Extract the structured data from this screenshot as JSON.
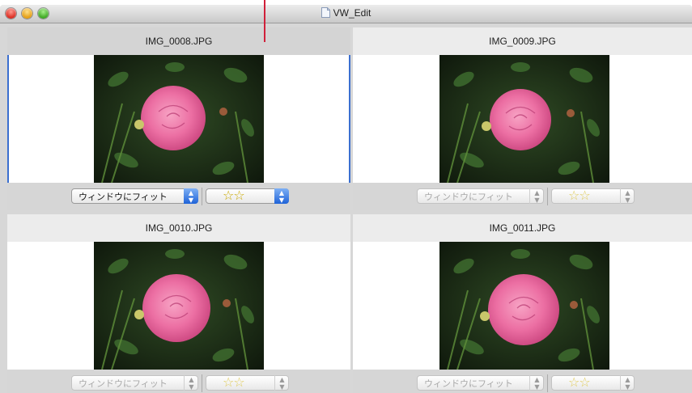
{
  "window": {
    "title": "VW_Edit"
  },
  "panes": [
    {
      "filename": "IMG_0008.JPG",
      "zoom_label": "ウィンドウにフィット",
      "rating_label": "☆☆",
      "active": true
    },
    {
      "filename": "IMG_0009.JPG",
      "zoom_label": "ウィンドウにフィット",
      "rating_label": "☆☆",
      "active": false
    },
    {
      "filename": "IMG_0010.JPG",
      "zoom_label": "ウィンドウにフィット",
      "rating_label": "☆☆",
      "active": false
    },
    {
      "filename": "IMG_0011.JPG",
      "zoom_label": "ウィンドウにフィット",
      "rating_label": "☆☆",
      "active": false
    }
  ],
  "colors": {
    "selection_border": "#3b6fd0",
    "pointer_line": "#d0203a"
  }
}
